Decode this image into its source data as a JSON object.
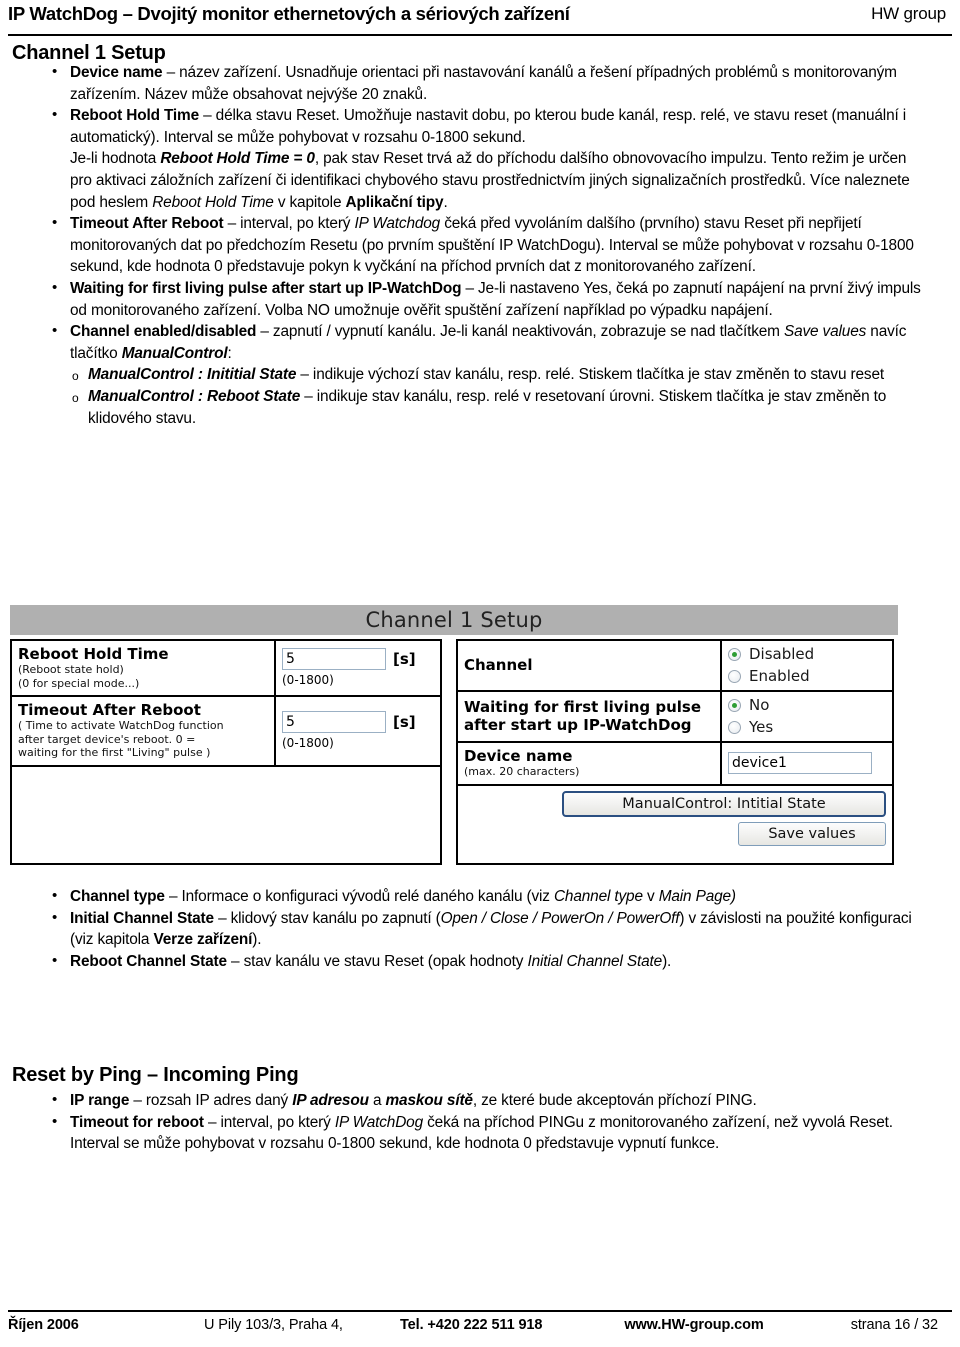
{
  "header": {
    "title": "IP WatchDog – Dvojitý monitor ethernetových a sériových zařízení",
    "brand": "HW group"
  },
  "headings": {
    "channel_setup": "Channel 1 Setup",
    "reset_by_ping": "Reset by Ping – Incoming Ping"
  },
  "channel_setup_list": [
    {
      "id": "device-name",
      "segments": [
        {
          "text": "Device name",
          "style": "b"
        },
        {
          "text": " – název zařízení. Usnadňuje orientaci při nastavování kanálů a řešení případných problémů s monitorovaným zařízením. Název může obsahovat nejvýše 20 znaků.",
          "style": ""
        }
      ]
    },
    {
      "id": "reboot-hold-time",
      "segments": [
        {
          "text": "Reboot Hold Time",
          "style": "b"
        },
        {
          "text": " – délka stavu Reset. Umožňuje nastavit dobu, po kterou bude kanál, resp. relé, ve stavu reset (manuální i automatický). Interval se může pohybovat v rozsahu 0-1800 sekund.",
          "style": ""
        }
      ]
    },
    {
      "id": "reboot-hold-time-zero",
      "plain": true,
      "segments": [
        {
          "text": "Je-li hodnota ",
          "style": ""
        },
        {
          "text": "Reboot Hold Time  = 0",
          "style": "bi"
        },
        {
          "text": ", pak stav Reset trvá až do příchodu dalšího obnovovacího impulzu. Tento režim je určen pro aktivaci záložních zařízení či identifikaci chybového stavu prostřednictvím jiných signalizačních prostředků. Více naleznete pod heslem ",
          "style": ""
        },
        {
          "text": "Reboot Hold Time",
          "style": "i"
        },
        {
          "text": " v kapitole ",
          "style": ""
        },
        {
          "text": "Aplikační tipy",
          "style": "b"
        },
        {
          "text": ".",
          "style": ""
        }
      ]
    },
    {
      "id": "timeout-after-reboot",
      "segments": [
        {
          "text": "Timeout After Reboot",
          "style": "b"
        },
        {
          "text": " – interval, po který ",
          "style": ""
        },
        {
          "text": "IP Watchdog",
          "style": "i"
        },
        {
          "text": " čeká před vyvoláním dalšího (prvního) stavu Reset při nepřijetí monitorovaných dat po předchozím Resetu (po prvním spuštění IP WatchDogu). Interval se může pohybovat v rozsahu 0-1800 sekund, kde hodnota 0 představuje pokyn k vyčkání na příchod prvních dat z monitorovaného zařízení.",
          "style": ""
        }
      ]
    },
    {
      "id": "waiting-first-living-pulse",
      "segments": [
        {
          "text": "Waiting for first living pulse after start up IP-WatchDog",
          "style": "b"
        },
        {
          "text": " – Je-li nastaveno Yes, čeká po zapnutí napájení na první živý impuls od monitorovaného zařízení. Volba NO umožnuje ověřit spuštění zařízení například po výpadku napájení.",
          "style": ""
        }
      ]
    },
    {
      "id": "channel-enabled-disabled",
      "segments": [
        {
          "text": "Channel enabled/disabled",
          "style": "b"
        },
        {
          "text": " – zapnutí / vypnutí kanálu. Je-li kanál neaktivován, zobrazuje se nad tlačítkem ",
          "style": ""
        },
        {
          "text": "Save values",
          "style": "i"
        },
        {
          "text": " navíc tlačítko ",
          "style": ""
        },
        {
          "text": "ManualControl",
          "style": "bi"
        },
        {
          "text": ":",
          "style": ""
        }
      ]
    },
    {
      "id": "manualcontrol-initial-state",
      "sub": true,
      "segments": [
        {
          "text": "ManualControl : Inititial State",
          "style": "bi"
        },
        {
          "text": " – indikuje výchozí stav kanálu, resp. relé. Stiskem tlačítka je stav změněn to stavu reset",
          "style": ""
        }
      ]
    },
    {
      "id": "manualcontrol-reboot-state",
      "sub": true,
      "segments": [
        {
          "text": "ManualControl : Reboot State",
          "style": "bi"
        },
        {
          "text": " – indikuje stav kanálu, resp. relé v resetovaní úrovni. Stiskem tlačítka je stav změněn to klidového stavu.",
          "style": ""
        }
      ]
    }
  ],
  "channel_props_list": [
    {
      "id": "channel-type",
      "segments": [
        {
          "text": "Channel type",
          "style": "b"
        },
        {
          "text": " – Informace o konfiguraci vývodů relé daného kanálu (viz ",
          "style": ""
        },
        {
          "text": "Channel type",
          "style": "i"
        },
        {
          "text": " v ",
          "style": ""
        },
        {
          "text": "Main Page)",
          "style": "i"
        }
      ]
    },
    {
      "id": "initial-channel-state",
      "segments": [
        {
          "text": "Initial Channel State",
          "style": "b"
        },
        {
          "text": " – klidový stav kanálu po zapnutí (",
          "style": ""
        },
        {
          "text": "Open / Close / PowerOn / PowerOff",
          "style": "i"
        },
        {
          "text": ") v závislosti na použité konfiguraci (viz kapitola ",
          "style": ""
        },
        {
          "text": "Verze zařízení",
          "style": "b"
        },
        {
          "text": ").",
          "style": ""
        }
      ]
    },
    {
      "id": "reboot-channel-state",
      "segments": [
        {
          "text": "Reboot Channel State",
          "style": "b"
        },
        {
          "text": " – stav kanálu ve stavu Reset (opak hodnoty ",
          "style": ""
        },
        {
          "text": "Initial Channel State",
          "style": "i"
        },
        {
          "text": ").",
          "style": ""
        }
      ]
    }
  ],
  "reset_by_ping_list": [
    {
      "id": "ip-range",
      "segments": [
        {
          "text": "IP range",
          "style": "b"
        },
        {
          "text": " – rozsah IP adres daný ",
          "style": ""
        },
        {
          "text": "IP adresou",
          "style": "bi"
        },
        {
          "text": " a ",
          "style": ""
        },
        {
          "text": "maskou sítě",
          "style": "bi"
        },
        {
          "text": ", ze které bude akceptován příchozí PING.",
          "style": ""
        }
      ]
    },
    {
      "id": "timeout-for-reboot",
      "segments": [
        {
          "text": "Timeout for reboot",
          "style": "b"
        },
        {
          "text": " – interval, po který ",
          "style": ""
        },
        {
          "text": "IP WatchDog",
          "style": "i"
        },
        {
          "text": " čeká na příchod PINGu z monitorovaného zařízení, než vyvolá Reset. Interval se může pohybovat v rozsahu 0-1800 sekund, kde hodnota 0 představuje vypnutí funkce.",
          "style": ""
        }
      ]
    }
  ],
  "screenshot": {
    "title": "Channel 1 Setup",
    "left_panel": {
      "reboot_hold_time": {
        "label": "Reboot Hold Time",
        "sub1": "(Reboot state hold)",
        "sub2": "(0 for special mode...)",
        "value": "5",
        "unit": "[s]",
        "range": "(0-1800)"
      },
      "timeout_after_reboot": {
        "label": "Timeout After Reboot",
        "sub1": "( Time to activate WatchDog function",
        "sub2": "after target device's reboot. 0 =",
        "sub3": "waiting for the first \"Living\" pulse )",
        "value": "5",
        "unit": "[s]",
        "range": "(0-1800)"
      }
    },
    "right_panel": {
      "channel": {
        "label": "Channel",
        "options": [
          {
            "label": "Disabled",
            "checked": true
          },
          {
            "label": "Enabled",
            "checked": false
          }
        ]
      },
      "waiting_pulse": {
        "label_line1": "Waiting for first living pulse",
        "label_line2": "after start up IP-WatchDog",
        "options": [
          {
            "label": "No",
            "checked": true
          },
          {
            "label": "Yes",
            "checked": false
          }
        ]
      },
      "device_name": {
        "label": "Device name",
        "sub": "(max. 20 characters)",
        "value": "device1"
      },
      "manual_control_button": "ManualControl: Intitial State",
      "save_button": "Save values"
    }
  },
  "footer": {
    "date": "Říjen 2006",
    "address": "U Pily 103/3,  Praha 4,",
    "tel": "Tel. +420 222 511 918",
    "web": "www.HW-group.com",
    "page": "strana 16 / 32"
  },
  "colors": {
    "titlebar": "#b0b0b0",
    "radio_checked": "#2f9e35",
    "button_border": "#2b4f81"
  }
}
